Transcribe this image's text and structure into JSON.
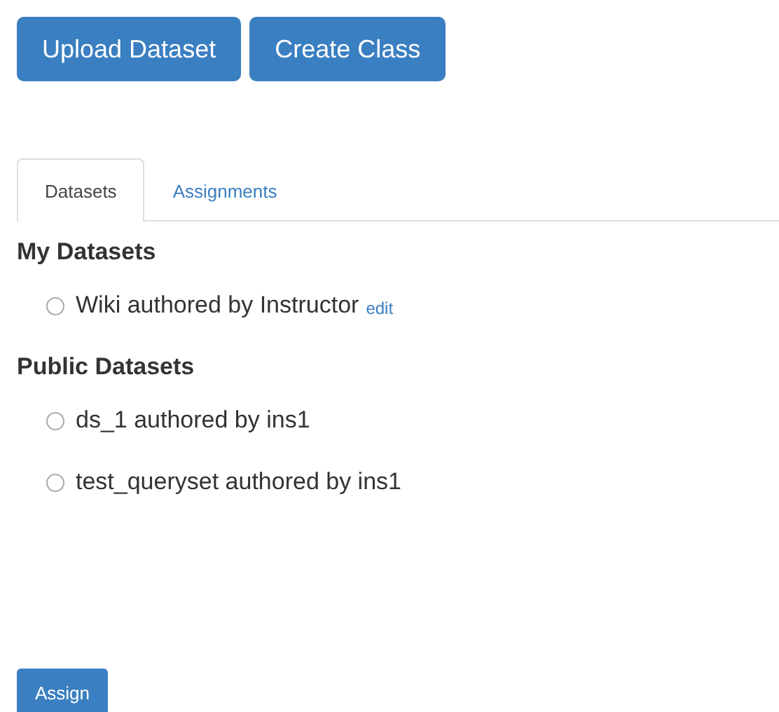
{
  "buttons": [
    "Upload Dataset",
    "Create Class"
  ],
  "tabs": [
    {
      "label": "Datasets",
      "selected": true
    },
    {
      "label": "Assignments",
      "selected": false
    }
  ],
  "sections": [
    {
      "title": "My Datasets",
      "items": [
        {
          "label": "Wiki authored by Instructor",
          "selected": false,
          "link": "edit"
        }
      ]
    },
    {
      "title": "Public Datasets",
      "items": [
        {
          "label": "ds_1 authored by ins1",
          "selected": false
        },
        {
          "label": "test_queryset authored by ins1",
          "selected": false
        }
      ]
    }
  ],
  "submit": "Assign"
}
